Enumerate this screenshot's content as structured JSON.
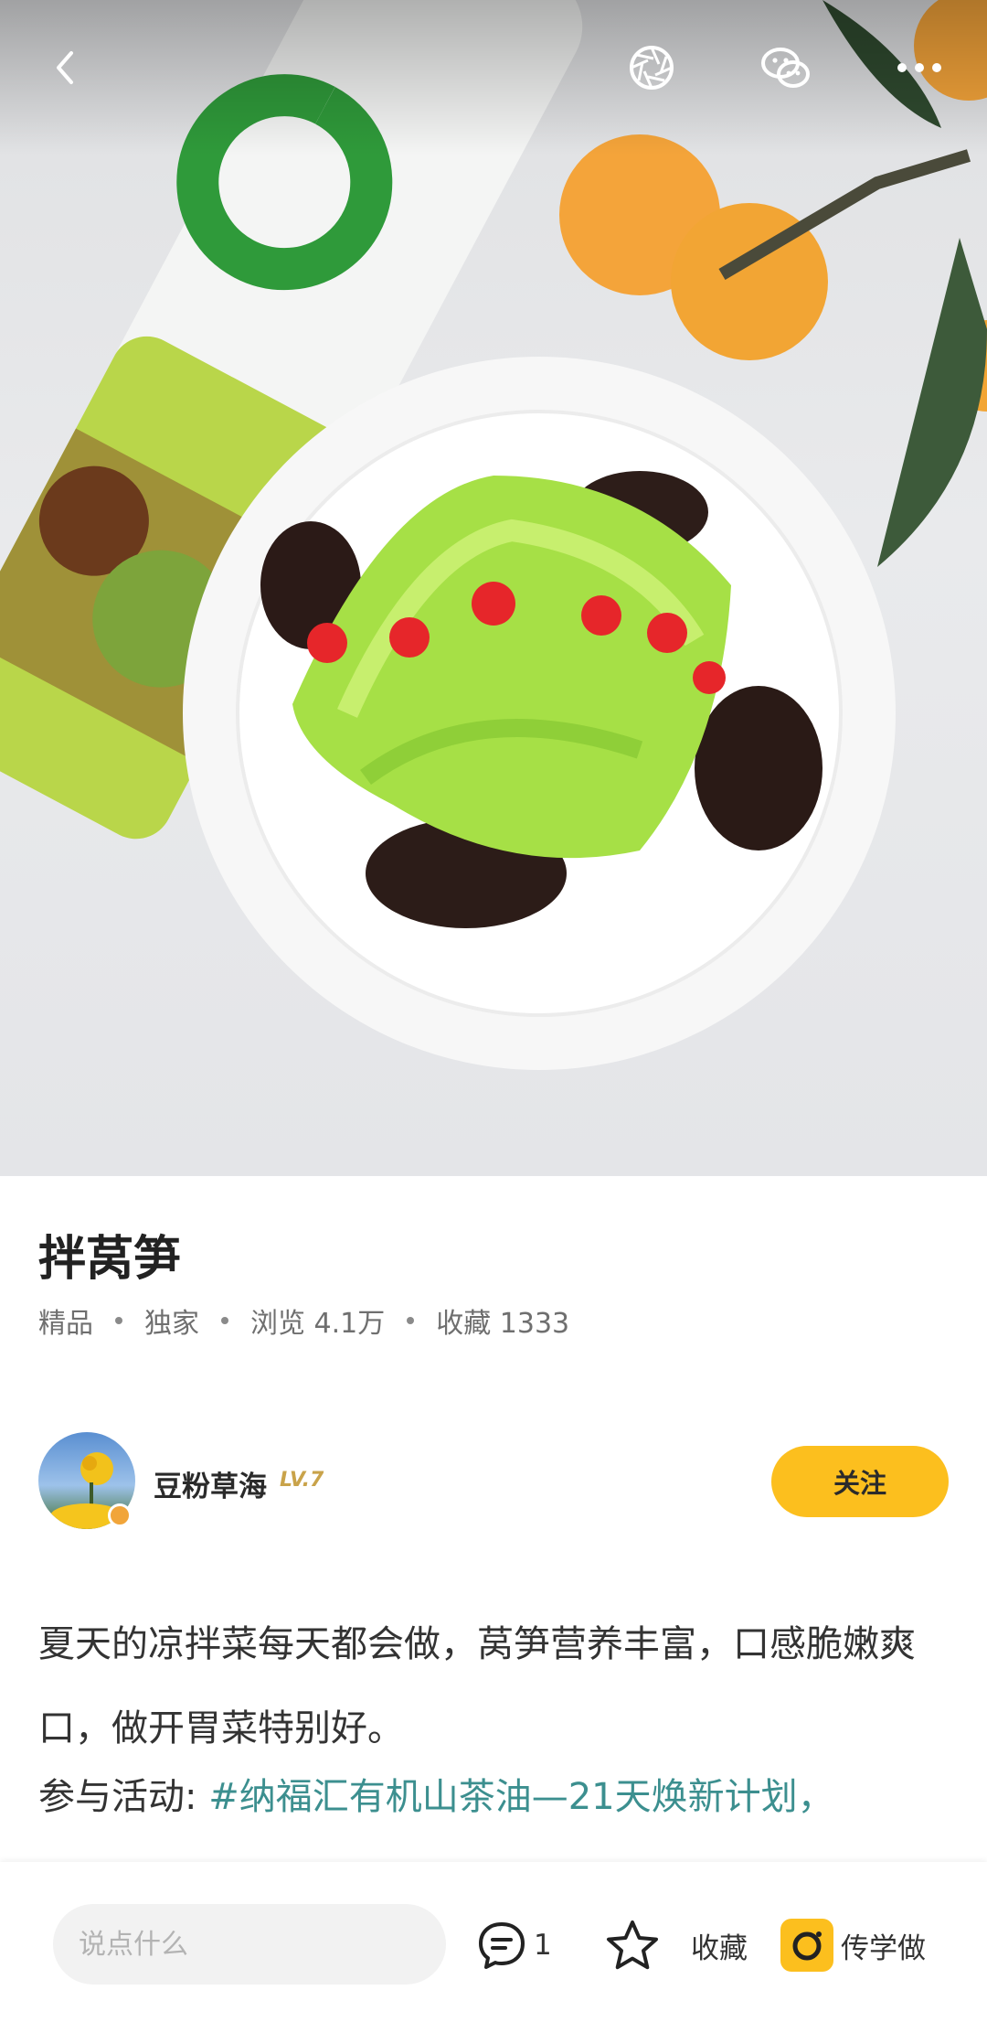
{
  "topbar": {
    "back_icon": "back-chevron-icon",
    "camera_icon": "shutter-icon",
    "share_icon": "wechat-icon",
    "more_icon": "more-dots-icon"
  },
  "recipe": {
    "title": "拌莴笋",
    "meta": {
      "tag1": "精品",
      "tag2": "独家",
      "views": "浏览 4.1万",
      "favorites": "收藏 1333"
    }
  },
  "author": {
    "name": "豆粉草海",
    "level": "LV.7",
    "follow_label": "关注"
  },
  "description": "夏天的凉拌菜每天都会做，莴笋营养丰富，口感脆嫩爽口，做开胃菜特别好。",
  "activity": {
    "prefix": "参与活动: ",
    "link": "#纳福汇有机山茶油—21天焕新计划，"
  },
  "bottombar": {
    "comment_placeholder": "说点什么",
    "comment_count": "1",
    "favorite_label": "收藏",
    "learn_label": "传学做"
  },
  "colors": {
    "accent": "#fcbf1e",
    "link": "#3c8f8f",
    "level": "#c9a34a"
  }
}
